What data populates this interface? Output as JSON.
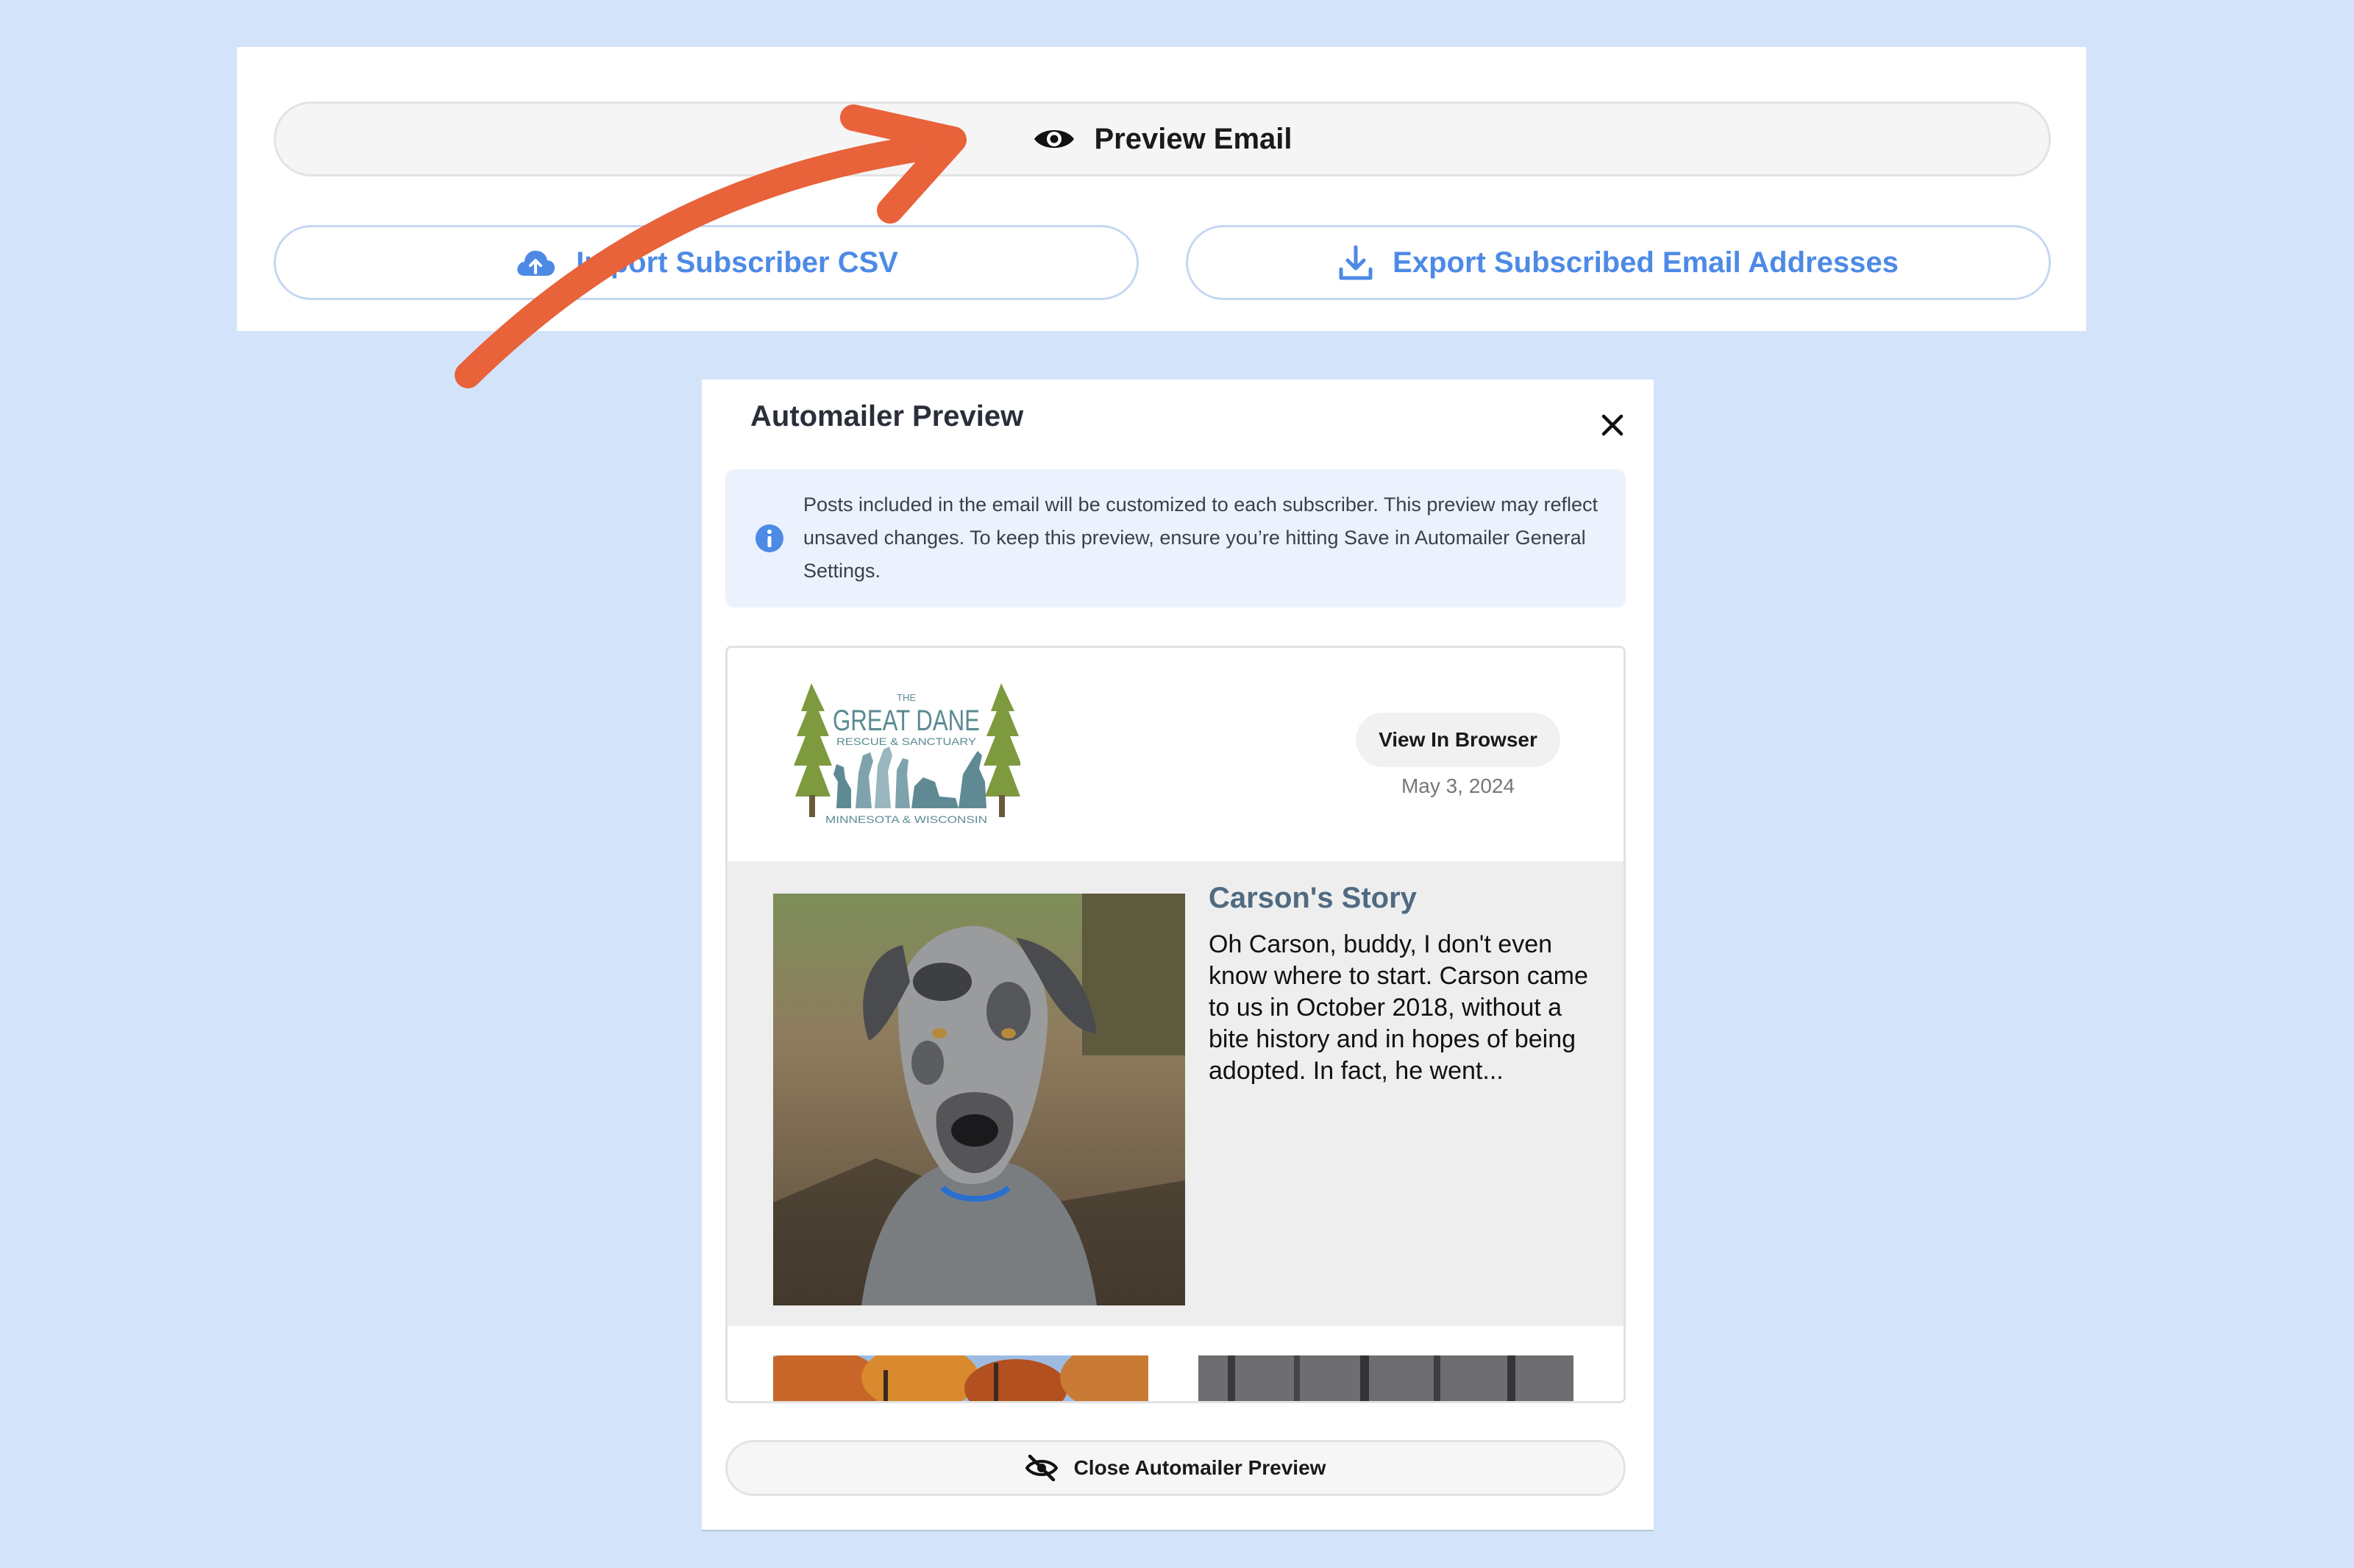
{
  "toolbar": {
    "preview_email_label": "Preview Email",
    "import_label": "Import Subscriber CSV",
    "export_label": "Export Subscribed Email Addresses"
  },
  "modal": {
    "title": "Automailer Preview",
    "info_text": "Posts included in the email will be customized to each subscriber. This preview may reflect unsaved changes. To keep this preview, ensure you’re hitting Save in Automailer General Settings.",
    "close_preview_label": "Close Automailer Preview"
  },
  "email": {
    "logo": {
      "small_text": "THE",
      "main_text": "GREAT DANE",
      "sub_text": "RESCUE & SANCTUARY",
      "bottom_text": "MINNESOTA & WISCONSIN"
    },
    "view_in_browser_label": "View In Browser",
    "date": "May 3, 2024",
    "story": {
      "title": "Carson's Story",
      "excerpt": "Oh Carson, buddy, I don't even know where to start. Carson came to us in October 2018, without a bite history and in hopes of being adopted. In fact, he went..."
    }
  },
  "colors": {
    "background": "#d3e3fa",
    "accent_blue": "#4d8ae6",
    "arrow_orange": "#e8623a",
    "story_title": "#506a82"
  },
  "icons": {
    "preview": "eye-icon",
    "import": "cloud-upload-icon",
    "export": "download-icon",
    "info": "info-icon",
    "close": "close-icon",
    "close_preview": "eye-slash-icon"
  }
}
